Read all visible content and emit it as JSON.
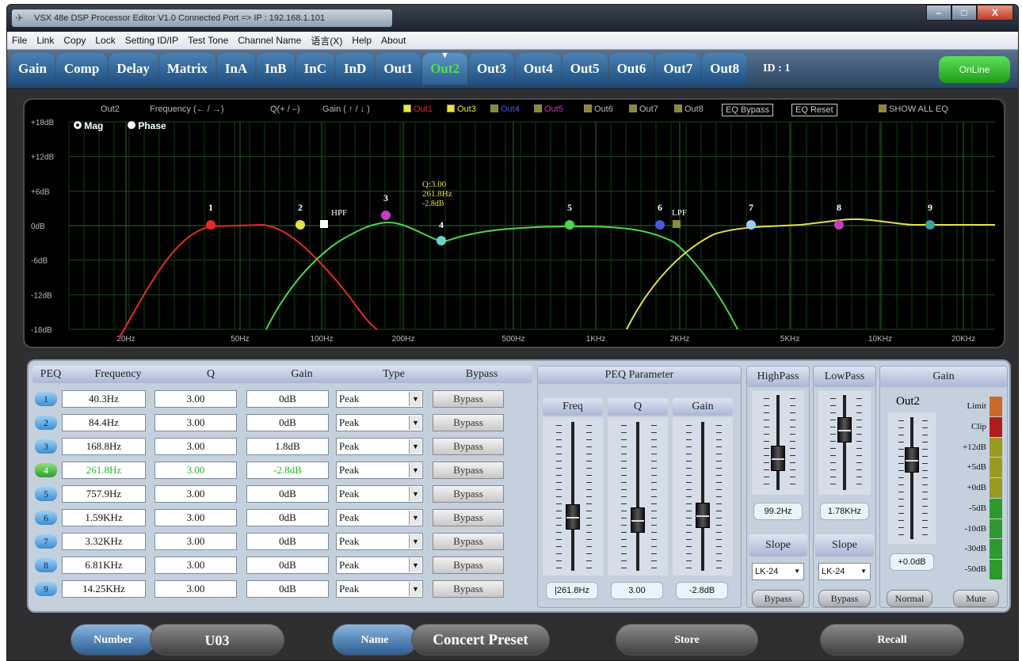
{
  "window": {
    "title": "VSX 48e DSP Processor Editor V1.0    Connected Port => IP : 192.168.1.101",
    "buttons": [
      "–",
      "□",
      "X"
    ]
  },
  "menu": [
    "File",
    "Link",
    "Copy",
    "Lock",
    "Setting ID/IP",
    "Test Tone",
    "Channel Name",
    "语言(X)",
    "Help",
    "About"
  ],
  "tabs": [
    "Gain",
    "Comp",
    "Delay",
    "Matrix",
    "InA",
    "InB",
    "InC",
    "InD",
    "Out1",
    "Out2",
    "Out3",
    "Out4",
    "Out5",
    "Out6",
    "Out7",
    "Out8"
  ],
  "active_tab": "Out2",
  "device_id": "ID : 1",
  "online_label": "OnLine",
  "graph": {
    "channel": "Out2",
    "hint_freq": "Frequency  (← / →)",
    "hint_q": "Q(+ / –)",
    "hint_gain": "Gain ( ↑ / ↓ )",
    "outputs": [
      "Out1",
      "Out3",
      "Out4",
      "Out5",
      "Out6",
      "Out7",
      "Out8"
    ],
    "eq_bypass": "EQ Bypass",
    "eq_reset": "EQ Reset",
    "show_all": "SHOW ALL EQ",
    "mag_label": "Mag",
    "phase_label": "Phase",
    "y_labels": [
      "+18dB",
      "+12dB",
      "+6dB",
      "0dB",
      "-6dB",
      "-12dB",
      "-18dB"
    ],
    "x_labels": [
      "20Hz",
      "50Hz",
      "100Hz",
      "200Hz",
      "500Hz",
      "1KHz",
      "2KHz",
      "5KHz",
      "10KHz",
      "20KHz"
    ],
    "point_labels": [
      "1",
      "2",
      "3",
      "4",
      "5",
      "6",
      "7",
      "8",
      "9"
    ],
    "hpf_label": "HPF",
    "lpf_label": "LPF",
    "tooltip": [
      "Q:3.00",
      "261.8Hz",
      "-2.8dB"
    ]
  },
  "peq": {
    "headers": [
      "PEQ",
      "Frequency",
      "Q",
      "Gain",
      "Type",
      "Bypass"
    ],
    "rows": [
      {
        "n": "1",
        "freq": "40.3Hz",
        "q": "3.00",
        "gain": "0dB",
        "type": "Peak",
        "bypass": "Bypass"
      },
      {
        "n": "2",
        "freq": "84.4Hz",
        "q": "3.00",
        "gain": "0dB",
        "type": "Peak",
        "bypass": "Bypass"
      },
      {
        "n": "3",
        "freq": "168.8Hz",
        "q": "3.00",
        "gain": "1.8dB",
        "type": "Peak",
        "bypass": "Bypass"
      },
      {
        "n": "4",
        "freq": "261.8Hz",
        "q": "3.00",
        "gain": "-2.8dB",
        "type": "Peak",
        "bypass": "Bypass"
      },
      {
        "n": "5",
        "freq": "757.9Hz",
        "q": "3.00",
        "gain": "0dB",
        "type": "Peak",
        "bypass": "Bypass"
      },
      {
        "n": "6",
        "freq": "1.59KHz",
        "q": "3.00",
        "gain": "0dB",
        "type": "Peak",
        "bypass": "Bypass"
      },
      {
        "n": "7",
        "freq": "3.32KHz",
        "q": "3.00",
        "gain": "0dB",
        "type": "Peak",
        "bypass": "Bypass"
      },
      {
        "n": "8",
        "freq": "6.81KHz",
        "q": "3.00",
        "gain": "0dB",
        "type": "Peak",
        "bypass": "Bypass"
      },
      {
        "n": "9",
        "freq": "14.25KHz",
        "q": "3.00",
        "gain": "0dB",
        "type": "Peak",
        "bypass": "Bypass"
      }
    ]
  },
  "peq_param": {
    "title": "PEQ Parameter",
    "freq_label": "Freq",
    "q_label": "Q",
    "gain_label": "Gain",
    "freq_value": "|261.8Hz",
    "q_value": "3.00",
    "gain_value": "-2.8dB"
  },
  "highpass": {
    "title": "HighPass",
    "value": "99.2Hz",
    "slope_label": "Slope",
    "slope": "LK-24",
    "bypass": "Bypass"
  },
  "lowpass": {
    "title": "LowPass",
    "value": "1.78KHz",
    "slope_label": "Slope",
    "slope": "LK-24",
    "bypass": "Bypass"
  },
  "gain": {
    "title": "Gain",
    "channel": "Out2",
    "value": "+0.0dB",
    "normal": "Normal",
    "mute": "Mute",
    "meter_labels": [
      "Limit",
      "Clip",
      "+12dB",
      "+5dB",
      "+0dB",
      "-5dB",
      "-10dB",
      "-30dB",
      "-50dB"
    ]
  },
  "footer": {
    "number_label": "Number",
    "number_value": "U03",
    "name_label": "Name",
    "name_value": "Concert Preset",
    "store": "Store",
    "recall": "Recall"
  }
}
